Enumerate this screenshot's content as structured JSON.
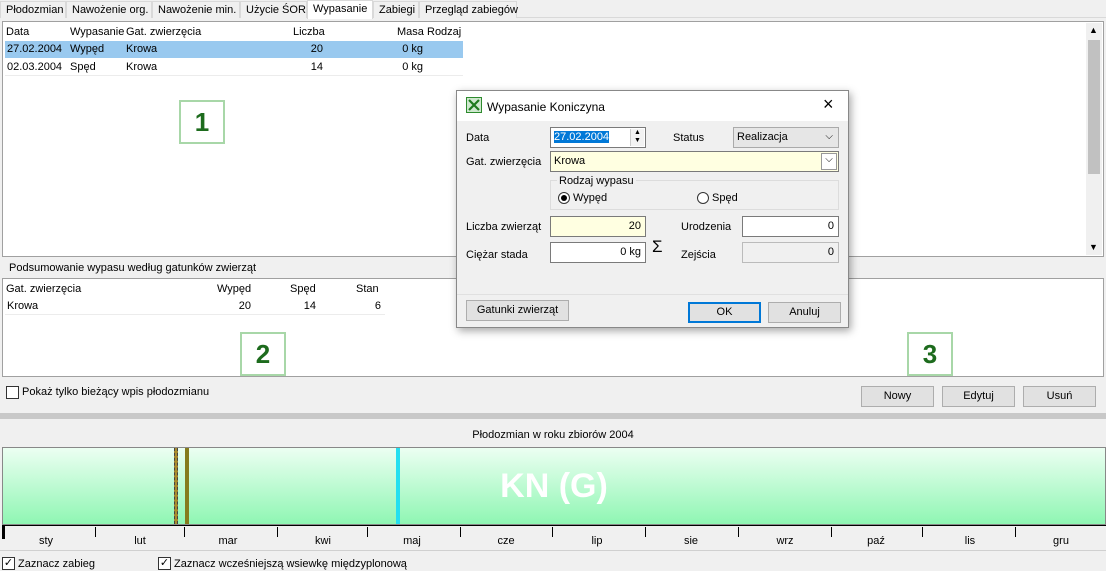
{
  "tabs": [
    {
      "label": "Płodozmian"
    },
    {
      "label": "Nawożenie org."
    },
    {
      "label": "Nawożenie min."
    },
    {
      "label": "Użycie ŚOR"
    },
    {
      "label": "Wypasanie"
    },
    {
      "label": "Zabiegi"
    },
    {
      "label": "Przegląd zabiegów"
    }
  ],
  "grazing_table": {
    "headers": {
      "data": "Data",
      "wypasanie": "Wypasanie",
      "gat": "Gat. zwierzęcia",
      "liczba": "Liczba",
      "masa": "Masa",
      "rodzaj": "Rodzaj"
    },
    "rows": [
      {
        "data": "27.02.2004",
        "wypasanie": "Wypęd",
        "gat": "Krowa",
        "liczba": "20",
        "masa": "0 kg"
      },
      {
        "data": "02.03.2004",
        "wypasanie": "Spęd",
        "gat": "Krowa",
        "liczba": "14",
        "masa": "0 kg"
      }
    ]
  },
  "badges": {
    "one": "1",
    "two": "2",
    "three": "3"
  },
  "summary": {
    "title": "Podsumowanie wypasu według gatunków zwierząt",
    "headers": {
      "gat": "Gat. zwierzęcia",
      "wyped": "Wypęd",
      "sped": "Spęd",
      "stan": "Stan"
    },
    "rows": [
      {
        "gat": "Krowa",
        "wyped": "20",
        "sped": "14",
        "stan": "6"
      }
    ]
  },
  "show_current_only": {
    "label": "Pokaż tylko bieżący wpis płodozmianu",
    "checked": false
  },
  "actions": {
    "new": "Nowy",
    "edit": "Edytuj",
    "delete": "Usuń"
  },
  "timeline": {
    "title": "Płodozmian w roku zbiorów 2004",
    "crop_label": "KN (G)",
    "months": [
      "sty",
      "lut",
      "mar",
      "kwi",
      "maj",
      "cze",
      "lip",
      "sie",
      "wrz",
      "paź",
      "lis",
      "gru"
    ],
    "bar_color": "#a6f7c2"
  },
  "bottom_checks": {
    "mark_treatment": {
      "label": "Zaznacz zabieg",
      "checked": true
    },
    "mark_earlier": {
      "label": "Zaznacz wcześniejszą wsiewkę międzyplonową",
      "checked": true
    }
  },
  "dialog": {
    "title": "Wypasanie Koniczyna",
    "close": "×",
    "date_label": "Data",
    "date_value": "27.02.2004",
    "status_label": "Status",
    "status_value": "Realizacja",
    "species_label": "Gat. zwierzęcia",
    "species_value": "Krowa",
    "group_title": "Rodzaj wypasu",
    "opt_wyped": "Wypęd",
    "opt_sped": "Spęd",
    "selected": "Wypęd",
    "count_label": "Liczba zwierząt",
    "count_value": "20",
    "births_label": "Urodzenia",
    "births_value": "0",
    "weight_label": "Ciężar stada",
    "weight_value": "0 kg",
    "sigma": "Σ",
    "deaths_label": "Zejścia",
    "deaths_value": "0",
    "species_btn": "Gatunki zwierząt",
    "ok": "OK",
    "cancel": "Anuluj"
  }
}
